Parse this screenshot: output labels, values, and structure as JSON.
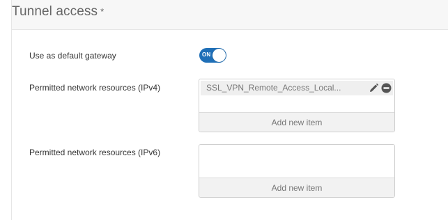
{
  "section": {
    "title": "Tunnel access",
    "required_marker": "*"
  },
  "fields": {
    "default_gateway": {
      "label": "Use as default gateway",
      "toggle_state": "ON",
      "toggle_color": "#1f6fb7"
    },
    "ipv4": {
      "label": "Permitted network resources (IPv4)",
      "items": [
        "SSL_VPN_Remote_Access_Local..."
      ],
      "item_icons": [
        "pencil-icon",
        "minus-circle-icon"
      ],
      "add_label": "Add new item"
    },
    "ipv6": {
      "label": "Permitted network resources (IPv6)",
      "items": [],
      "add_label": "Add new item"
    }
  }
}
